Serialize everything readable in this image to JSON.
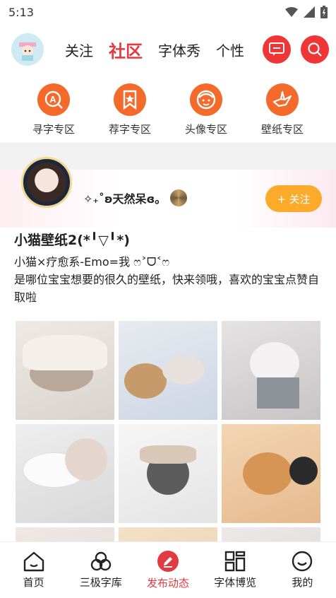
{
  "status": {
    "time": "5:13"
  },
  "nav": {
    "tabs": [
      {
        "label": "关注"
      },
      {
        "label": "社区"
      },
      {
        "label": "字体秀"
      },
      {
        "label": "个性"
      }
    ],
    "accent": "#e23a40"
  },
  "zones": [
    {
      "label": "寻字专区",
      "icon": "search-font-icon"
    },
    {
      "label": "荐字专区",
      "icon": "star-bookmark-icon"
    },
    {
      "label": "头像专区",
      "icon": "face-icon"
    },
    {
      "label": "壁纸专区",
      "icon": "paper-crane-icon"
    }
  ],
  "post": {
    "username": "✧₊˚ʚ天然呆ɞ。",
    "follow_label": "+ 关注",
    "title": "小猫壁纸2(*╹▽╹*)",
    "line1": "小猫×疗愈系-Emo=我 ෆ˃ᗜ˂ෆ",
    "line2": "是哪位宝宝想要的很久的壁纸，快来领哦，喜欢的宝宝点赞自取啦"
  },
  "bottom_nav": [
    {
      "label": "首页",
      "icon": "home-icon"
    },
    {
      "label": "三极字库",
      "icon": "circles-icon"
    },
    {
      "label": "发布动态",
      "icon": "edit-icon"
    },
    {
      "label": "字体博览",
      "icon": "grid-icon"
    },
    {
      "label": "我的",
      "icon": "smile-icon"
    }
  ]
}
